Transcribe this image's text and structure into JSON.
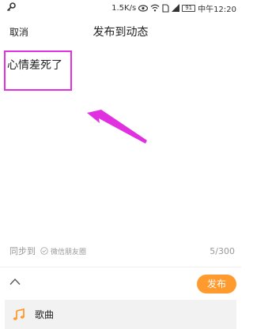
{
  "status_bar": {
    "speed": "1.5K/s",
    "battery": "91",
    "time": "中午12:20"
  },
  "header": {
    "cancel_label": "取消",
    "title": "发布到动态"
  },
  "composer": {
    "text": "心情差死了"
  },
  "sync": {
    "label": "同步到",
    "wechat_label": "微信朋友圈"
  },
  "char_count": "5/300",
  "toolbar": {
    "publish_label": "发布"
  },
  "song_row": {
    "label": "歌曲"
  },
  "colors": {
    "accent": "#ff9a2e",
    "annotation": "#e030e0"
  }
}
